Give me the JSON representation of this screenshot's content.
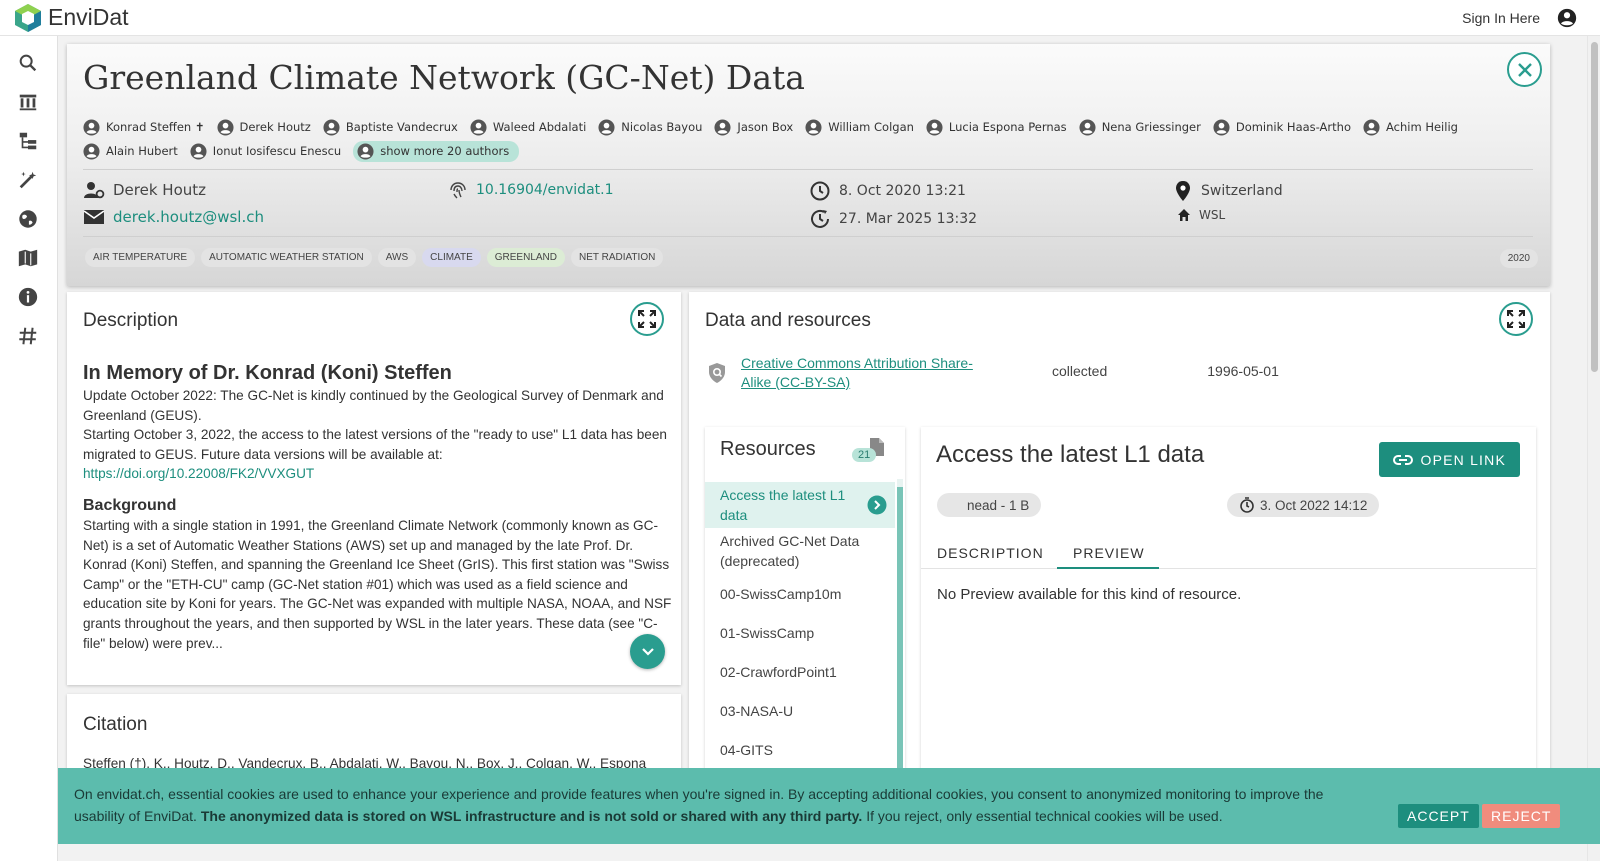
{
  "app": {
    "name": "EnviDat",
    "sign_in": "Sign In Here"
  },
  "sidebar": {
    "items": [
      {
        "icon": "search-icon"
      },
      {
        "icon": "catalog-icon"
      },
      {
        "icon": "tree-icon"
      },
      {
        "icon": "tools-icon"
      },
      {
        "icon": "globe-icon"
      },
      {
        "icon": "guide-book-icon"
      },
      {
        "icon": "info-icon"
      },
      {
        "icon": "hashtag-icon"
      }
    ]
  },
  "dataset": {
    "title": "Greenland Climate Network (GC-Net) Data",
    "authors_row1": [
      "Konrad Steffen ✝",
      "Derek Houtz",
      "Baptiste Vandecrux",
      "Waleed Abdalati",
      "Nicolas Bayou",
      "Jason Box",
      "William Colgan",
      "Lucia Espona Pernas",
      "Nena Griessinger",
      "Dominik Haas-Artho",
      "Achim Heilig"
    ],
    "authors_row2": [
      "Alain Hubert",
      "Ionut Iosifescu Enescu"
    ],
    "show_more": "show more 20 authors",
    "contact_name": "Derek Houtz",
    "contact_email": "derek.houtz@wsl.ch",
    "doi": "10.16904/envidat.1",
    "created": "8. Oct 2020 13:21",
    "modified": "27. Mar 2025 13:32",
    "location": "Switzerland",
    "organization": "WSL",
    "tags": [
      {
        "label": "AIR TEMPERATURE",
        "color": "#e3e3e3"
      },
      {
        "label": "AUTOMATIC WEATHER STATION",
        "color": "#e3e3e3"
      },
      {
        "label": "AWS",
        "color": "#e3e3e3"
      },
      {
        "label": "CLIMATE",
        "color": "#d8d9ef"
      },
      {
        "label": "GREENLAND",
        "color": "#dcecd5"
      },
      {
        "label": "NET RADIATION",
        "color": "#e3e3e3"
      }
    ],
    "year": "2020"
  },
  "description": {
    "title": "Description",
    "memory_heading": "In Memory of Dr. Konrad (Koni) Steffen",
    "para1": "Update October 2022: The GC-Net is kindly continued by the Geological Survey of Denmark and Greenland (GEUS).",
    "para2": "Starting October 3, 2022, the access to the latest versions of the \"ready to use\" L1 data has been migrated to GEUS. Future data versions will be available at:",
    "link": "https://doi.org/10.22008/FK2/VVXGUT",
    "background_heading": "Background",
    "para3": "Starting with a single station in 1991, the Greenland Climate Network (commonly known as GC-Net) is a set of Automatic Weather Stations (AWS) set up and managed by the late Prof. Dr. Konrad (Koni) Steffen, and spanning the Greenland Ice Sheet (GrIS). This first station was \"Swiss Camp\" or the \"ETH-CU\" camp (GC-Net station #01) which was used as a field science and education site by Koni for years. The GC-Net was expanded with multiple NASA, NOAA, and NSF grants throughout the years, and then supported by WSL in the later years. These data (see \"C-file\" below) were prev..."
  },
  "citation": {
    "title": "Citation",
    "text": "Steffen (†), K., Houtz, D., Vandecrux, B., Abdalati, W., Bayou, N., Box, J., Colgan, W., Espona"
  },
  "data_resources": {
    "title": "Data and resources",
    "license": "Creative Commons Attribution Share-Alike (CC-BY-SA)",
    "date_type": "collected",
    "date": "1996-05-01",
    "resources_title": "Resources",
    "resources_count": "21",
    "items": [
      "Access the latest L1 data",
      "Archived GC-Net Data (deprecated)",
      "00-SwissCamp10m",
      "01-SwissCamp",
      "02-CrawfordPoint1",
      "03-NASA-U",
      "04-GITS"
    ],
    "selected": {
      "title": "Access the latest L1 data",
      "open_link": "OPEN LINK",
      "format_chip": "nead - 1 B",
      "date_chip": "3. Oct 2022 14:12",
      "tab_description": "DESCRIPTION",
      "tab_preview": "PREVIEW",
      "preview_text": "No Preview available for this kind of resource."
    }
  },
  "cookie": {
    "text_before": "On envidat.ch, essential cookies are used to enhance your experience and provide features when you're signed in. By accepting additional cookies, you consent to anonymized monitoring to improve the usability of EnviDat. ",
    "text_bold": "The anonymized data is stored on WSL infrastructure and is not sold or shared with any third party.",
    "text_after": " If you reject, only essential technical cookies will be used.",
    "accept": "ACCEPT",
    "reject": "REJECT"
  },
  "colors": {
    "accent": "#1d8e7e",
    "accent_light": "#2a9d8f",
    "banner": "#5cbcad",
    "reject": "#f08c7d"
  }
}
